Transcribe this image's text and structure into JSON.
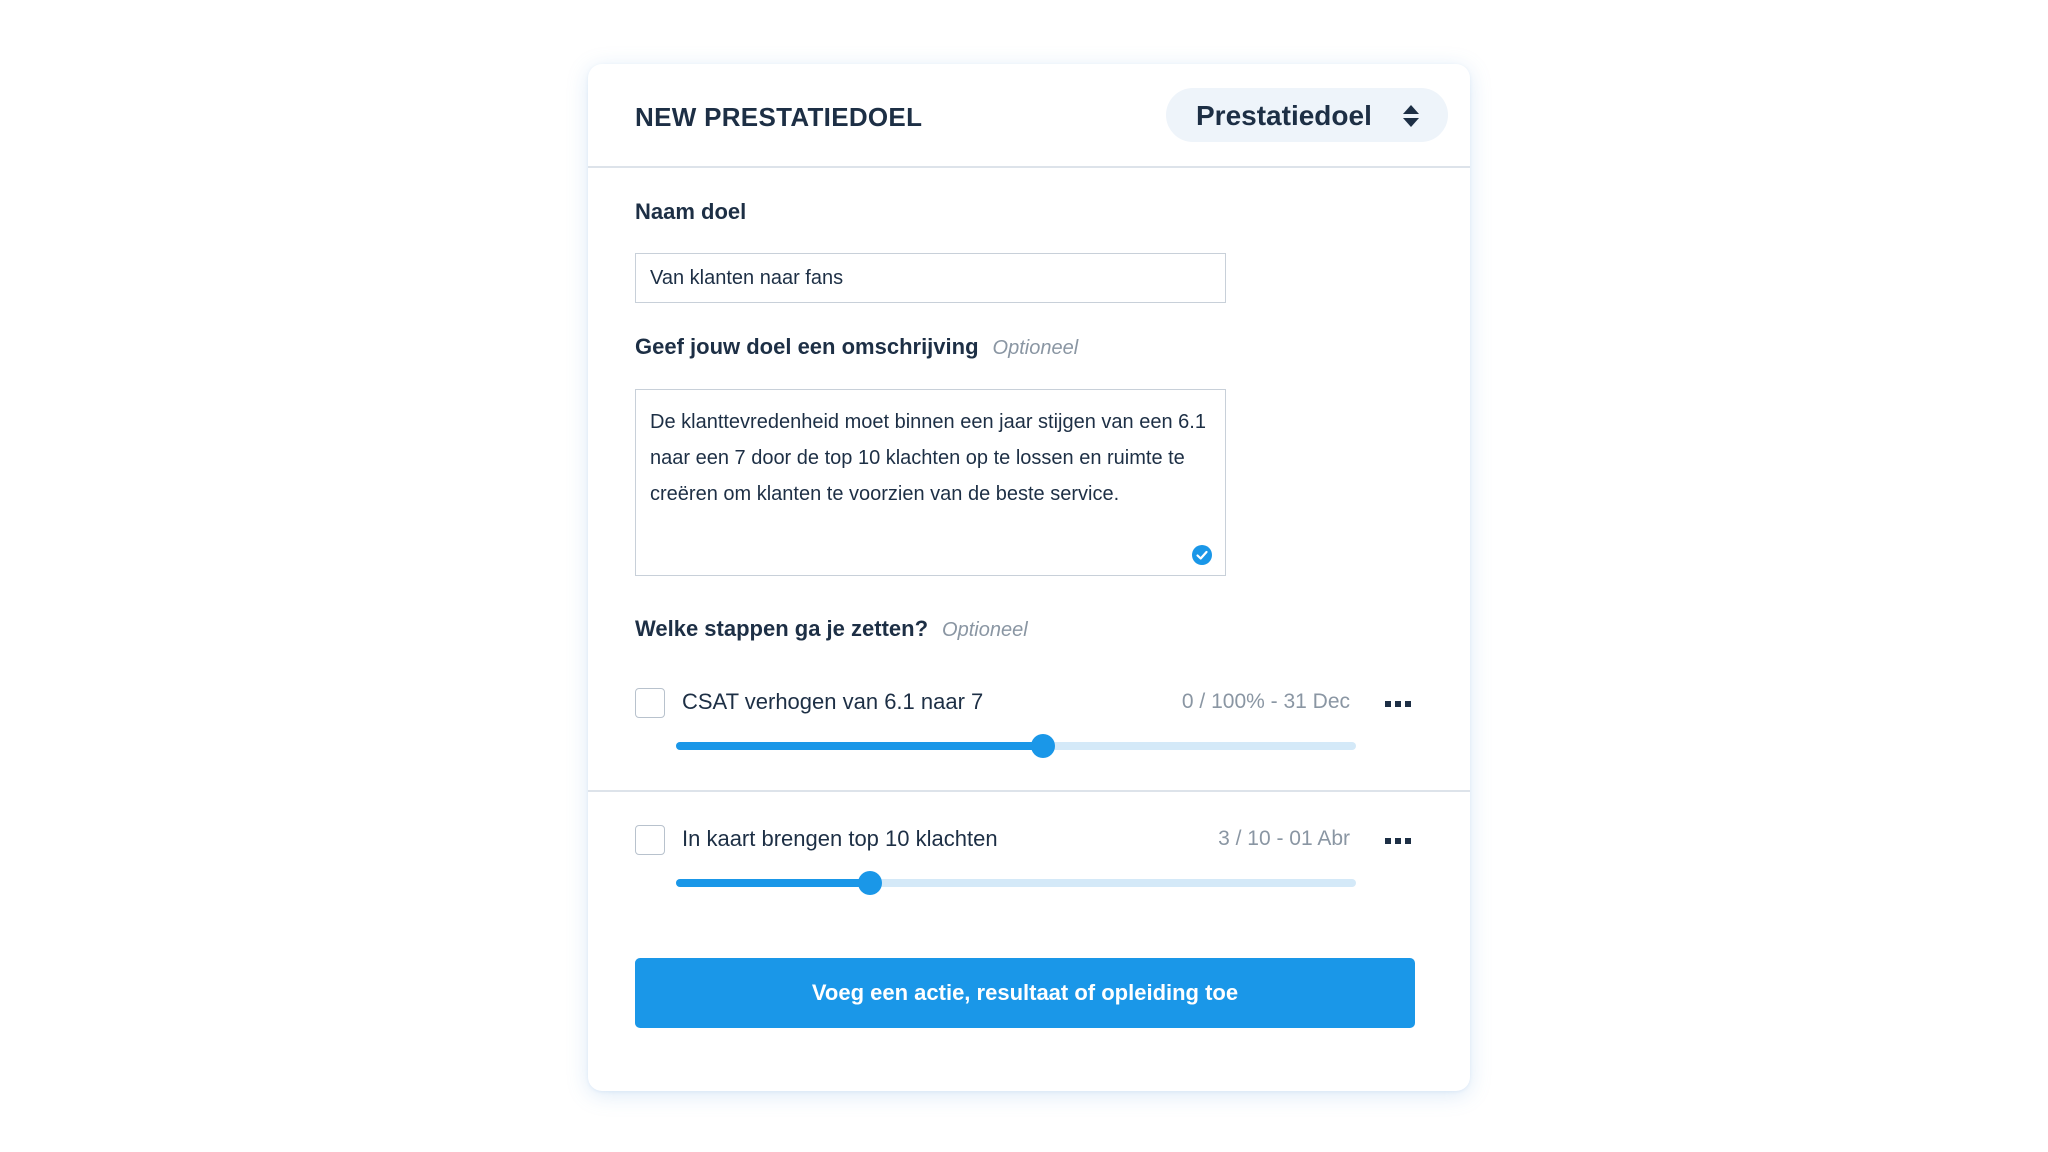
{
  "header": {
    "title": "NEW PRESTATIEDOEL",
    "type_select": {
      "selected": "Prestatiedoel",
      "icon": "sort-icon"
    }
  },
  "form": {
    "name": {
      "label": "Naam doel",
      "value": "Van klanten naar fans"
    },
    "description": {
      "label": "Geef jouw doel een omschrijving",
      "optional_tag": "Optioneel",
      "value": "De klanttevredenheid moet binnen een jaar stijgen van een 6.1 naar een 7 door de top 10 klachten op te lossen en ruimte te creëren om klanten te voorzien van de beste service.",
      "status_icon": "check-circle-icon"
    },
    "steps": {
      "label": "Welke stappen ga je zetten?",
      "optional_tag": "Optioneel",
      "items": [
        {
          "title": "CSAT verhogen van 6.1 naar 7",
          "meta": "0 / 100% - 31 Dec",
          "checked": false,
          "progress": 0.54
        },
        {
          "title": "In kaart brengen top 10 klachten",
          "meta": "3 / 10 - 01 Abr",
          "checked": false,
          "progress": 0.285
        }
      ]
    },
    "add_button_label": "Voeg een actie, resultaat of opleiding toe"
  },
  "colors": {
    "accent": "#1a97e8",
    "track": "#d4e9f8",
    "text": "#1d2f45",
    "muted": "#8a96a3"
  }
}
